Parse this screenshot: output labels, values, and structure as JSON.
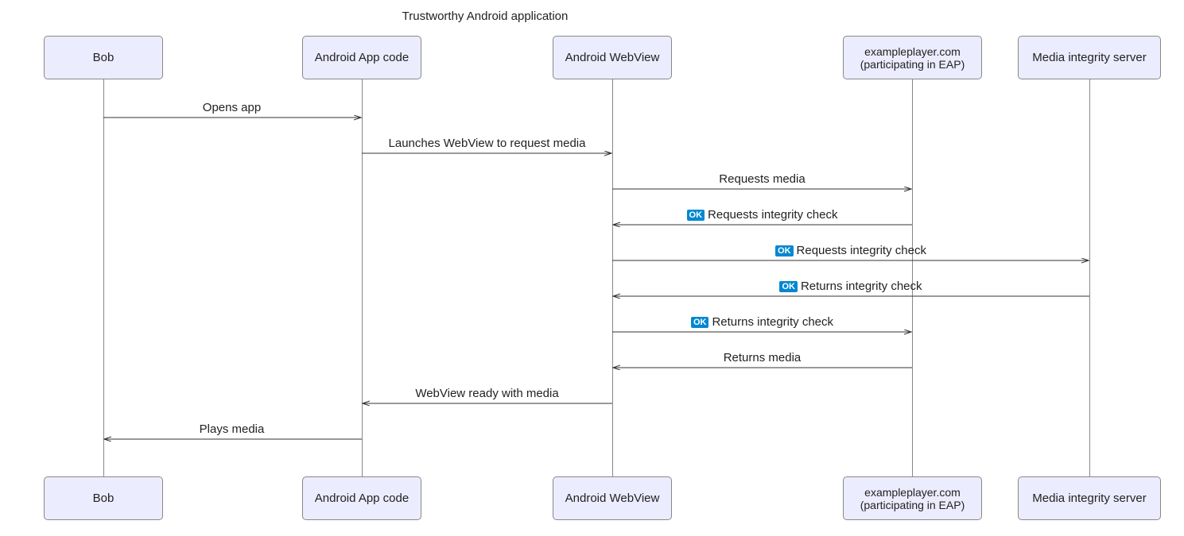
{
  "title": "Trustworthy Android application",
  "actors": {
    "bob": "Bob",
    "app": "Android App code",
    "webview": "Android WebView",
    "site": "exampleplayer.com\n(participating in EAP)",
    "server": "Media integrity server"
  },
  "messages": {
    "m1": "Opens app",
    "m2": "Launches WebView to request media",
    "m3": "Requests media",
    "m4": "Requests integrity check",
    "m5": "Requests integrity check",
    "m6": "Returns integrity check",
    "m7": "Returns integrity check",
    "m8": "Returns media",
    "m9": "WebView ready with media",
    "m10": "Plays media"
  },
  "badge": "OK"
}
